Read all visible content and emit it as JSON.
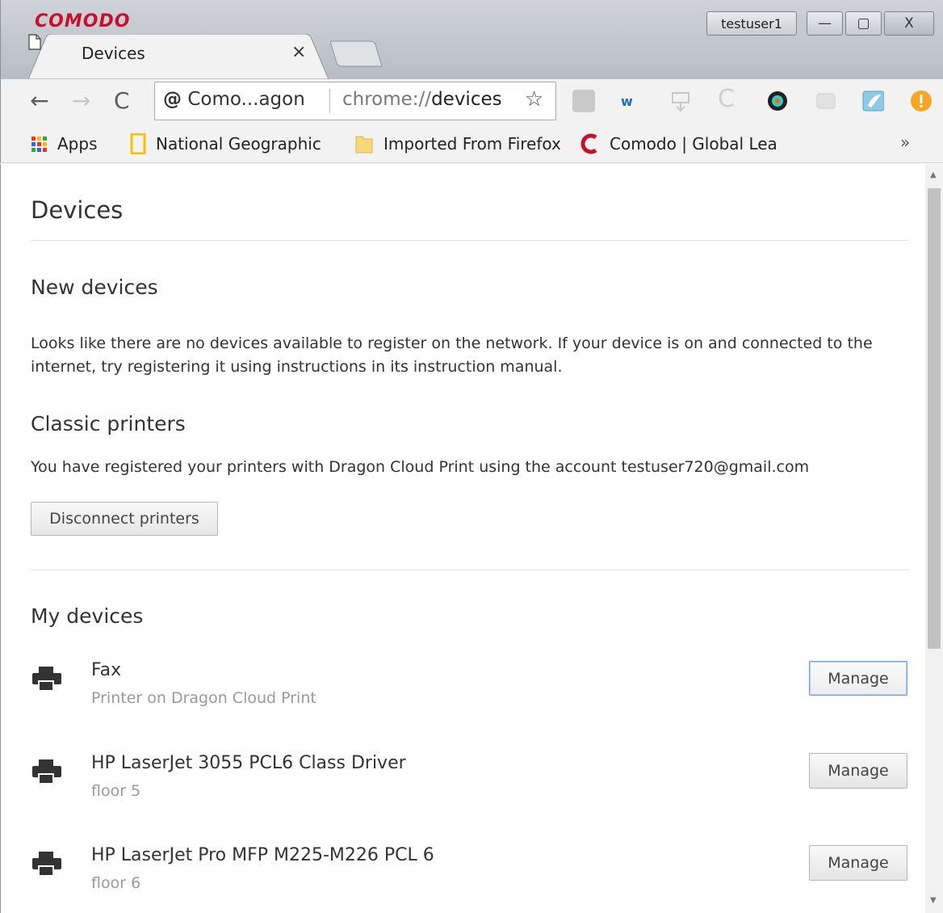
{
  "window": {
    "brand": "COMODO",
    "user": "testuser1",
    "minimize_glyph": "—",
    "maximize_glyph": "▢",
    "close_glyph": "X"
  },
  "tab": {
    "title": "Devices",
    "close_glyph": "×"
  },
  "toolbar": {
    "site_label": "Como...agon",
    "url_prefix": "chrome://",
    "url_path": "devices"
  },
  "bookmarks": [
    {
      "label": "Apps",
      "icon": "apps-grid-icon"
    },
    {
      "label": "National Geographic",
      "icon": "natgeo-icon"
    },
    {
      "label": "Imported From Firefox",
      "icon": "folder-icon"
    },
    {
      "label": "Comodo | Global Lea",
      "icon": "comodo-c-icon"
    }
  ],
  "bookmarks_more": "»",
  "page": {
    "title": "Devices",
    "new_devices": {
      "heading": "New devices",
      "message": "Looks like there are no devices available to register on the network. If your device is on and connected to the internet, try registering it using instructions in its instruction manual."
    },
    "classic_printers": {
      "heading": "Classic printers",
      "message": "You have registered your printers with Dragon Cloud Print using the account testuser720@gmail.com",
      "disconnect_label": "Disconnect printers"
    },
    "my_devices": {
      "heading": "My devices",
      "items": [
        {
          "name": "Fax",
          "description": "Printer on Dragon Cloud Print",
          "action": "Manage"
        },
        {
          "name": "HP LaserJet 3055 PCL6 Class Driver",
          "description": "floor 5",
          "action": "Manage"
        },
        {
          "name": "HP LaserJet Pro MFP M225-M226 PCL 6",
          "description": "floor 6",
          "action": "Manage"
        }
      ]
    }
  },
  "colors": {
    "brand_red": "#c8102e",
    "focus_blue": "#6f9fd8"
  }
}
